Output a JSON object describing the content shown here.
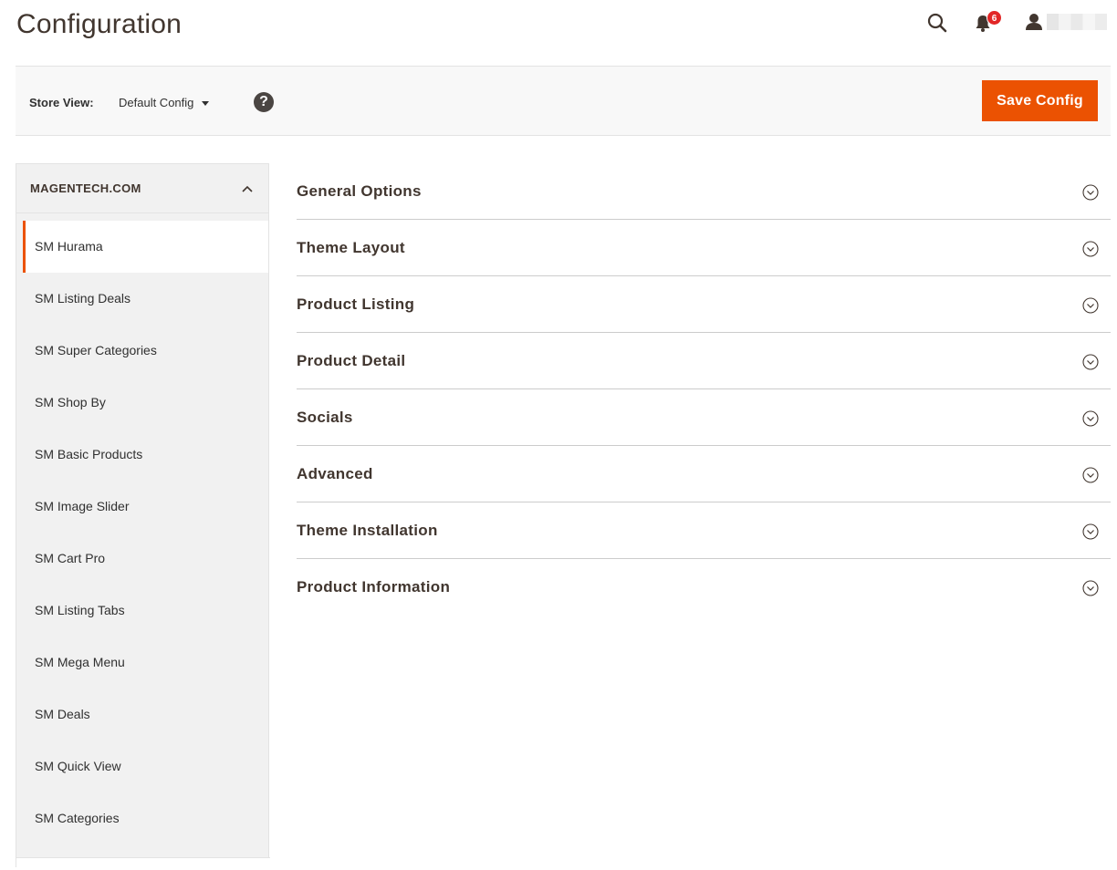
{
  "header": {
    "title": "Configuration",
    "notifications_count": "6"
  },
  "store_view": {
    "label": "Store View:",
    "selected": "Default Config",
    "help_symbol": "?",
    "save_label": "Save Config"
  },
  "sidebar": {
    "group_title": "MAGENTECH.COM",
    "items": [
      {
        "label": "SM Hurama",
        "active": true
      },
      {
        "label": "SM Listing Deals"
      },
      {
        "label": "SM Super Categories"
      },
      {
        "label": "SM Shop By"
      },
      {
        "label": "SM Basic Products"
      },
      {
        "label": "SM Image Slider"
      },
      {
        "label": "SM Cart Pro"
      },
      {
        "label": "SM Listing Tabs"
      },
      {
        "label": "SM Mega Menu"
      },
      {
        "label": "SM Deals"
      },
      {
        "label": "SM Quick View"
      },
      {
        "label": "SM Categories"
      }
    ]
  },
  "sections": [
    {
      "title": "General Options"
    },
    {
      "title": "Theme Layout"
    },
    {
      "title": "Product Listing"
    },
    {
      "title": "Product Detail"
    },
    {
      "title": "Socials"
    },
    {
      "title": "Advanced"
    },
    {
      "title": "Theme Installation"
    },
    {
      "title": "Product Information"
    }
  ],
  "colors": {
    "accent": "#eb5202",
    "badge": "#e22626",
    "text": "#41362f"
  },
  "icons": [
    "search-icon",
    "bell-icon",
    "user-icon",
    "help-icon",
    "chevron-up-icon",
    "chevron-down-circle-icon"
  ]
}
